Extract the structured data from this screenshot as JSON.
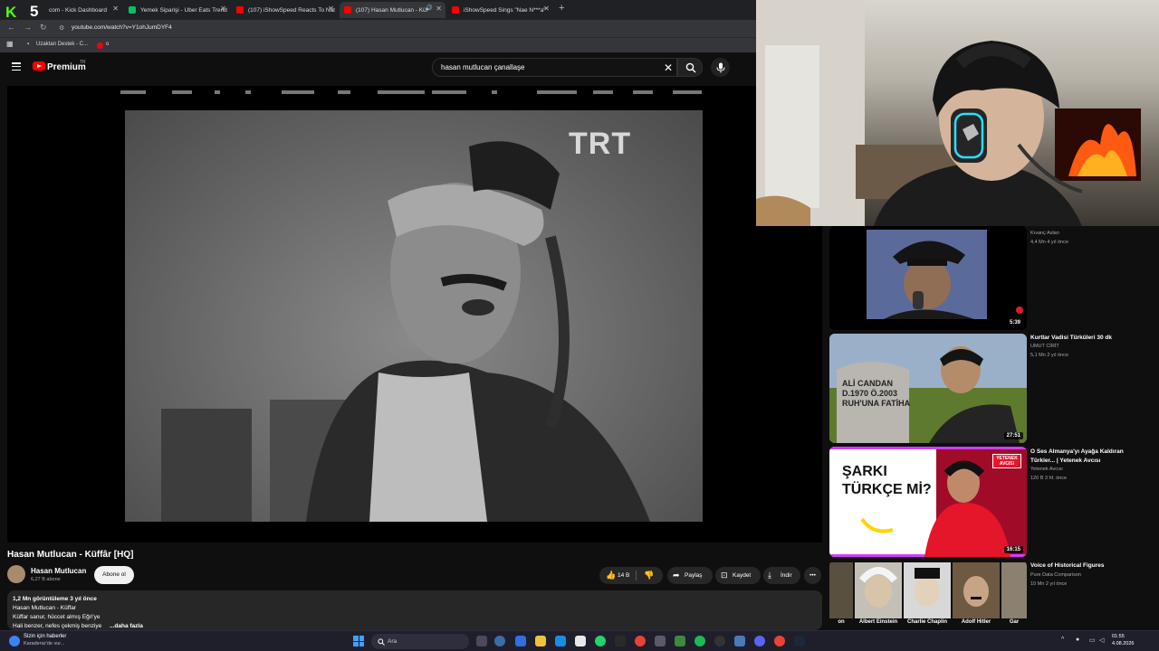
{
  "browser": {
    "tabs": [
      {
        "label": "com - Kick Dashboard",
        "favicon_color": "#53fc18"
      },
      {
        "label": "Yemek Siparişi - Uber Eats Trend",
        "favicon_color": "#06c167"
      },
      {
        "label": "(107) iShowSpeed Reacts To Nat",
        "favicon_color": "#ff0000"
      },
      {
        "label": "(107) Hasan Mutlucan - Küf",
        "favicon_color": "#ff0000"
      },
      {
        "label": "iShowSpeed Sings \"Nae N***a\"",
        "favicon_color": "#ff0000"
      }
    ],
    "url": "youtube.com/watch?v=Y1ohJumDYF4",
    "bookmarks": [
      "Uzaktan Destek - C...",
      "o"
    ]
  },
  "overlay": {
    "kick_logo": "K",
    "kick_count": "5"
  },
  "youtube": {
    "premium_label": "Premium",
    "region": "TR",
    "search_value": "hasan mutlucan çanallaşe",
    "watermark": "TRT",
    "video_title": "Hasan Mutlucan - Küffâr [HQ]",
    "channel": {
      "name": "Hasan Mutlucan",
      "subs": "6,27 B abone"
    },
    "subscribe_label": "Abone ol",
    "actions": {
      "likes": "14 B",
      "share": "Paylaş",
      "save": "Kaydet",
      "download": "İndir"
    },
    "description": {
      "stats": "1,2 Mn görüntüleme  3 yıl önce",
      "lines": [
        "Hasan Mutlucan - Küffar",
        "Küffar sanur, hüccet almış Eğri'ye",
        "Hali benzer, nefes çekmiş benziye"
      ],
      "more": "...daha fazla"
    }
  },
  "recommendations": [
    {
      "title": "",
      "channel": "Kıvanç Aslan",
      "meta": "4,4 Mn  4 yıl önce",
      "duration": "5:39"
    },
    {
      "title": "Kurtlar Vadisi Türküleri 30 dk",
      "channel": "UMUT CİRİT",
      "meta": "5,1 Mn  2 yıl önce",
      "duration": "27:51",
      "thumb_text": "ALİ CANDAN\nD.1970 Ö.2003\nRUH'UNA FATİHA"
    },
    {
      "title": "O Ses Almanya'yı Ayağa Kaldıran Türkler... | Yetenek Avcısı",
      "channel": "Yetenek Avcısı",
      "meta": "120 B  3 hf. önce",
      "duration": "16:15",
      "thumb_text": "ŞARKI TÜRKÇE Mİ?",
      "badge": "YETENEK AVCISI"
    },
    {
      "title": "Voice of Historical Figures",
      "channel": "Pure Data Comparison",
      "meta": "10 Mn  2 yıl önce",
      "duration": "",
      "names": [
        "on",
        "Albert Einstein",
        "Charlie Chaplin",
        "Adolf Hitler",
        "Gar"
      ]
    }
  ],
  "taskbar": {
    "news_title": "Sizin için haberler",
    "news_sub": "Karadeniz'de vur...",
    "search_placeholder": "Ara",
    "time": "01:55",
    "date": "4.08.2026"
  }
}
